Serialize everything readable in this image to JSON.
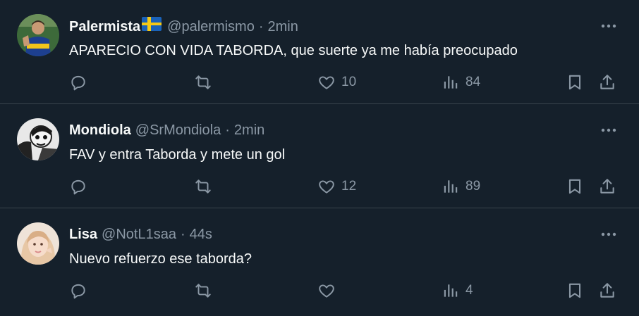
{
  "tweets": [
    {
      "name": "Palermista",
      "has_flag": true,
      "handle": "@palermismo",
      "separator": "·",
      "time": "2min",
      "text": "APARECIO CON VIDA TABORDA, que suerte ya me había preocupado",
      "likes": "10",
      "views": "84"
    },
    {
      "name": "Mondiola",
      "has_flag": false,
      "handle": "@SrMondiola",
      "separator": "·",
      "time": "2min",
      "text": "FAV y entra Taborda y mete un gol",
      "likes": "12",
      "views": "89"
    },
    {
      "name": "Lisa",
      "has_flag": false,
      "handle": "@NotL1saa",
      "separator": "·",
      "time": "44s",
      "text": "Nuevo refuerzo ese taborda?",
      "likes": "",
      "views": "4"
    }
  ],
  "colors": {
    "background": "#15202b",
    "text": "#f7f9f9",
    "muted": "#8b98a5",
    "divider": "#38444d"
  },
  "icons": [
    "more-icon",
    "reply-icon",
    "retweet-icon",
    "like-icon",
    "views-icon",
    "bookmark-icon",
    "share-icon",
    "sweden-flag-icon"
  ]
}
